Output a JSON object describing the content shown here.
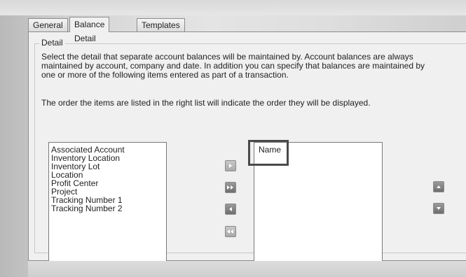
{
  "tabs": [
    {
      "label": "General"
    },
    {
      "label": "Balance Detail"
    },
    {
      "label": "Templates"
    }
  ],
  "detail_group": {
    "legend": "Detail",
    "description_lines": [
      "Select the detail that separate account balances will be maintained by.  Account balances are always",
      "maintained by account, company and date.  In addition you can specify that balances are maintained by",
      "one or more of the following items entered as part of a transaction."
    ],
    "order_note": "The order the items are listed in the right list will indicate the order they will be displayed."
  },
  "available_items": [
    "Associated Account",
    "Inventory Location",
    "Inventory Lot",
    "Location",
    "Profit Center",
    "Project",
    "Tracking Number 1",
    "Tracking Number 2"
  ],
  "selected_items": [
    "Name"
  ],
  "icons": {
    "add_one": "chevron-right-icon",
    "add_all": "double-chevron-right-icon",
    "remove_one": "chevron-left-icon",
    "remove_all": "double-chevron-left-icon",
    "move_up": "chevron-up-icon",
    "move_down": "chevron-down-icon"
  }
}
